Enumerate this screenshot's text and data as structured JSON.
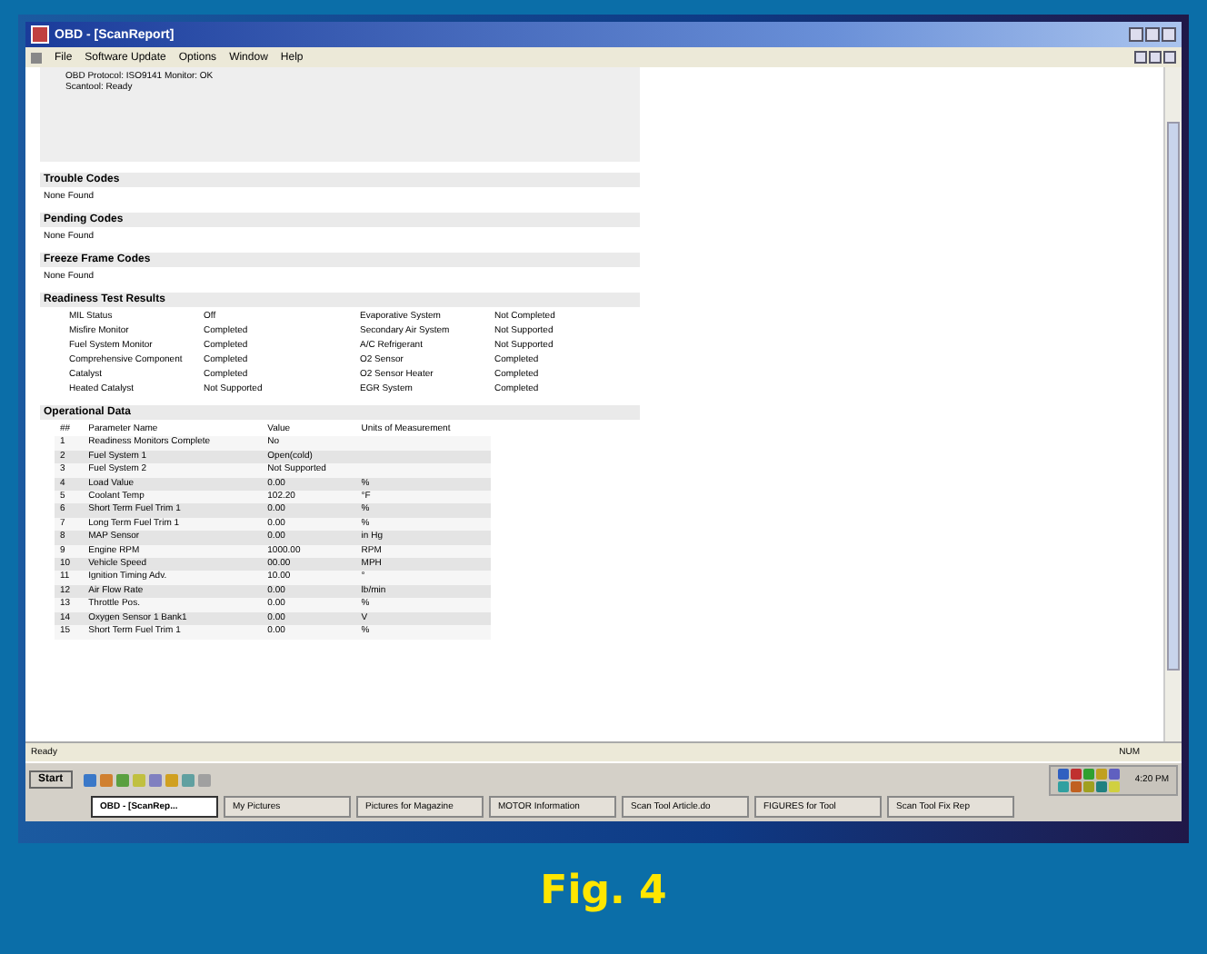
{
  "window": {
    "title": "OBD - [ScanReport]"
  },
  "menu": [
    "File",
    "Software Update",
    "Options",
    "Window",
    "Help"
  ],
  "summary_box": {
    "lines": [
      "OBD Protocol: ISO9141 Monitor: OK",
      "Scantool: Ready"
    ]
  },
  "sections": [
    {
      "title": "Trouble Codes",
      "text": "None Found"
    },
    {
      "title": "Pending Codes",
      "text": "None Found"
    },
    {
      "title": "Freeze Frame Codes",
      "text": "None Found"
    }
  ],
  "readiness": {
    "title": "Readiness Test Results",
    "items": [
      {
        "name": "MIL Status",
        "value": "Off"
      },
      {
        "name": "Misfire Monitor",
        "value": "Completed"
      },
      {
        "name": "Fuel System Monitor",
        "value": "Completed"
      },
      {
        "name": "Comprehensive Component",
        "value": "Completed"
      },
      {
        "name": "Catalyst",
        "value": "Completed"
      },
      {
        "name": "Heated Catalyst",
        "value": "Not Supported"
      },
      {
        "name": "Evaporative System",
        "value": "Not Completed"
      },
      {
        "name": "Secondary Air System",
        "value": "Not Supported"
      },
      {
        "name": "A/C Refrigerant",
        "value": "Not Supported"
      },
      {
        "name": "O2 Sensor",
        "value": "Completed"
      },
      {
        "name": "O2 Sensor Heater",
        "value": "Completed"
      },
      {
        "name": "EGR System",
        "value": "Completed"
      }
    ]
  },
  "operational": {
    "title": "Operational Data",
    "columns": [
      "##",
      "Parameter Name",
      "Value",
      "Units of Measurement"
    ],
    "rows": [
      [
        "1",
        "Readiness Monitors Complete",
        "No",
        ""
      ],
      [
        "2",
        "Fuel System 1",
        "Open(cold)",
        ""
      ],
      [
        "3",
        "Fuel System 2",
        "Not Supported",
        ""
      ],
      [
        "4",
        "Load Value",
        "0.00",
        "%"
      ],
      [
        "5",
        "Coolant Temp",
        "102.20",
        "°F"
      ],
      [
        "6",
        "Short Term Fuel Trim 1",
        "0.00",
        "%"
      ],
      [
        "7",
        "Long Term Fuel Trim 1",
        "0.00",
        "%"
      ],
      [
        "8",
        "MAP Sensor",
        "0.00",
        "in Hg"
      ],
      [
        "9",
        "Engine RPM",
        "1000.00",
        "RPM"
      ],
      [
        "10",
        "Vehicle Speed",
        "00.00",
        "MPH"
      ],
      [
        "11",
        "Ignition Timing Adv.",
        "10.00",
        "°"
      ],
      [
        "12",
        "Air Flow Rate",
        "0.00",
        "lb/min"
      ],
      [
        "13",
        "Throttle Pos.",
        "0.00",
        "%"
      ],
      [
        "14",
        "Oxygen Sensor 1 Bank1",
        "0.00",
        "V"
      ],
      [
        "15",
        "Short Term Fuel Trim 1",
        "0.00",
        "%"
      ]
    ]
  },
  "status_bar": {
    "left": "Ready",
    "right": "NUM"
  },
  "taskbar": {
    "start": "Start",
    "tasks": [
      {
        "label": "OBD - [ScanRep...",
        "selected": true
      },
      {
        "label": "My Pictures",
        "selected": false
      },
      {
        "label": "Pictures for Magazine",
        "selected": false
      },
      {
        "label": "MOTOR Information",
        "selected": false
      },
      {
        "label": "Scan Tool Article.do",
        "selected": false
      },
      {
        "label": "FIGURES for Tool",
        "selected": false
      },
      {
        "label": "Scan Tool Fix Rep",
        "selected": false
      }
    ],
    "clock": "4:20 PM"
  },
  "caption": "Fig. 4"
}
